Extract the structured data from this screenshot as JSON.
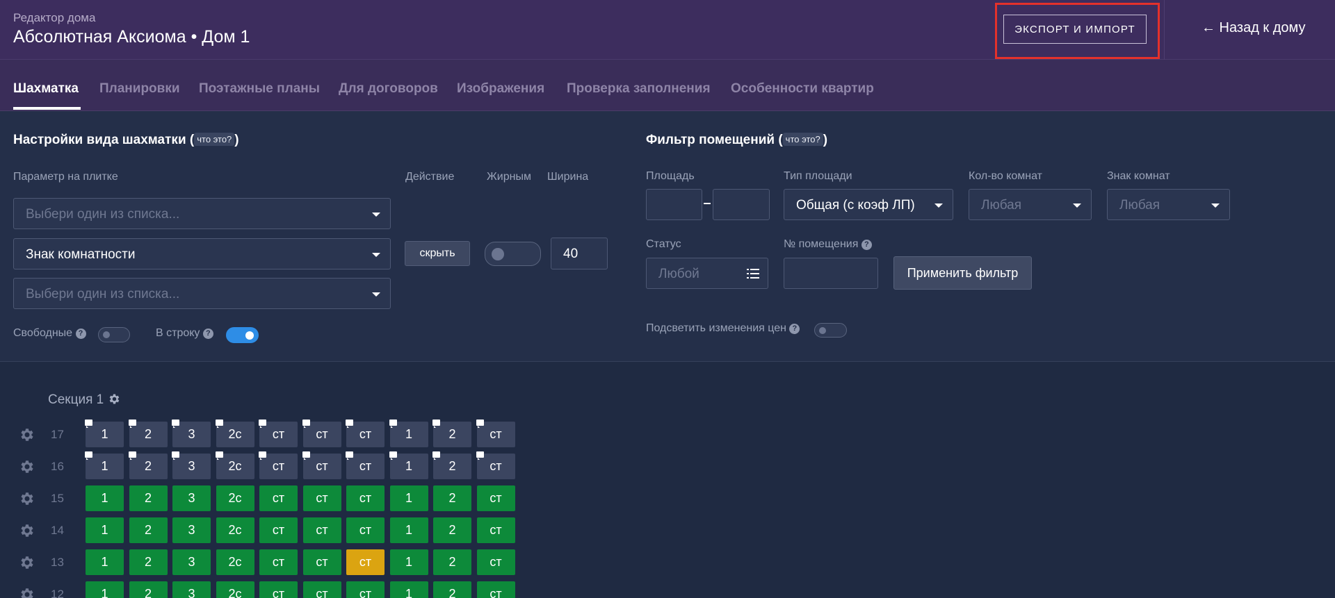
{
  "header": {
    "subtitle": "Редактор дома",
    "title": "Абсолютная Аксиома • Дом 1",
    "export_label": "ЭКСПОРТ И ИМПОРТ",
    "back_label": "← Назад к дому"
  },
  "tabs": [
    {
      "label": "Шахматка",
      "active": true
    },
    {
      "label": "Планировки"
    },
    {
      "label": "Поэтажные планы"
    },
    {
      "label": "Для договоров"
    },
    {
      "label": "Изображения"
    },
    {
      "label": "Проверка заполнения"
    },
    {
      "label": "Особенности квартир"
    }
  ],
  "view_settings": {
    "title": "Настройки вида шахматки",
    "help": "что это?",
    "col_param": "Параметр на плитке",
    "col_action": "Действие",
    "col_bold": "Жирным",
    "col_width": "Ширина",
    "select1_placeholder": "Выбери один из списка...",
    "select2_value": "Знак комнатности",
    "select3_placeholder": "Выбери один из списка...",
    "hide_label": "скрыть",
    "width_value": "40",
    "free_label": "Свободные",
    "inline_label": "В строку"
  },
  "filter": {
    "title": "Фильтр помещений",
    "help": "что это?",
    "area_label": "Площадь",
    "area_type_label": "Тип площади",
    "area_type_value": "Общая (с коэф ЛП)",
    "rooms_label": "Кол-во комнат",
    "rooms_value": "Любая",
    "rooms_sign_label": "Знак комнат",
    "rooms_sign_value": "Любая",
    "status_label": "Статус",
    "status_value": "Любой",
    "number_label": "№ помещения",
    "apply_label": "Применить фильтр",
    "highlight_label": "Подсветить изменения цен"
  },
  "grid": {
    "section_label": "Секция 1",
    "columns": [
      "1",
      "2",
      "3",
      "2с",
      "ст",
      "ст",
      "ст",
      "1",
      "2",
      "ст"
    ],
    "floors": [
      {
        "num": "17",
        "colors": [
          "gray",
          "gray",
          "gray",
          "gray",
          "gray",
          "gray",
          "gray",
          "gray",
          "gray",
          "gray"
        ],
        "bubbles": true
      },
      {
        "num": "16",
        "colors": [
          "gray",
          "gray",
          "gray",
          "gray",
          "gray",
          "gray",
          "gray",
          "gray",
          "gray",
          "gray"
        ],
        "bubbles": true
      },
      {
        "num": "15",
        "colors": [
          "green",
          "green",
          "green",
          "green",
          "green",
          "green",
          "green",
          "green",
          "green",
          "green"
        ],
        "bubbles": false
      },
      {
        "num": "14",
        "colors": [
          "green",
          "green",
          "green",
          "green",
          "green",
          "green",
          "green",
          "green",
          "green",
          "green"
        ],
        "bubbles": false
      },
      {
        "num": "13",
        "colors": [
          "green",
          "green",
          "green",
          "green",
          "green",
          "green",
          "yellow",
          "green",
          "green",
          "green"
        ],
        "bubbles": false
      },
      {
        "num": "12",
        "colors": [
          "green",
          "green",
          "green",
          "green",
          "green",
          "green",
          "green",
          "green",
          "green",
          "green"
        ],
        "bubbles": false
      }
    ]
  },
  "colors": {
    "header_bg": "#3d2d5e",
    "panel_bg": "#242f49",
    "available": "#0d8a3a",
    "reserved": "#dba411",
    "unavailable": "#3b4560",
    "highlight_border": "#e4312b"
  }
}
